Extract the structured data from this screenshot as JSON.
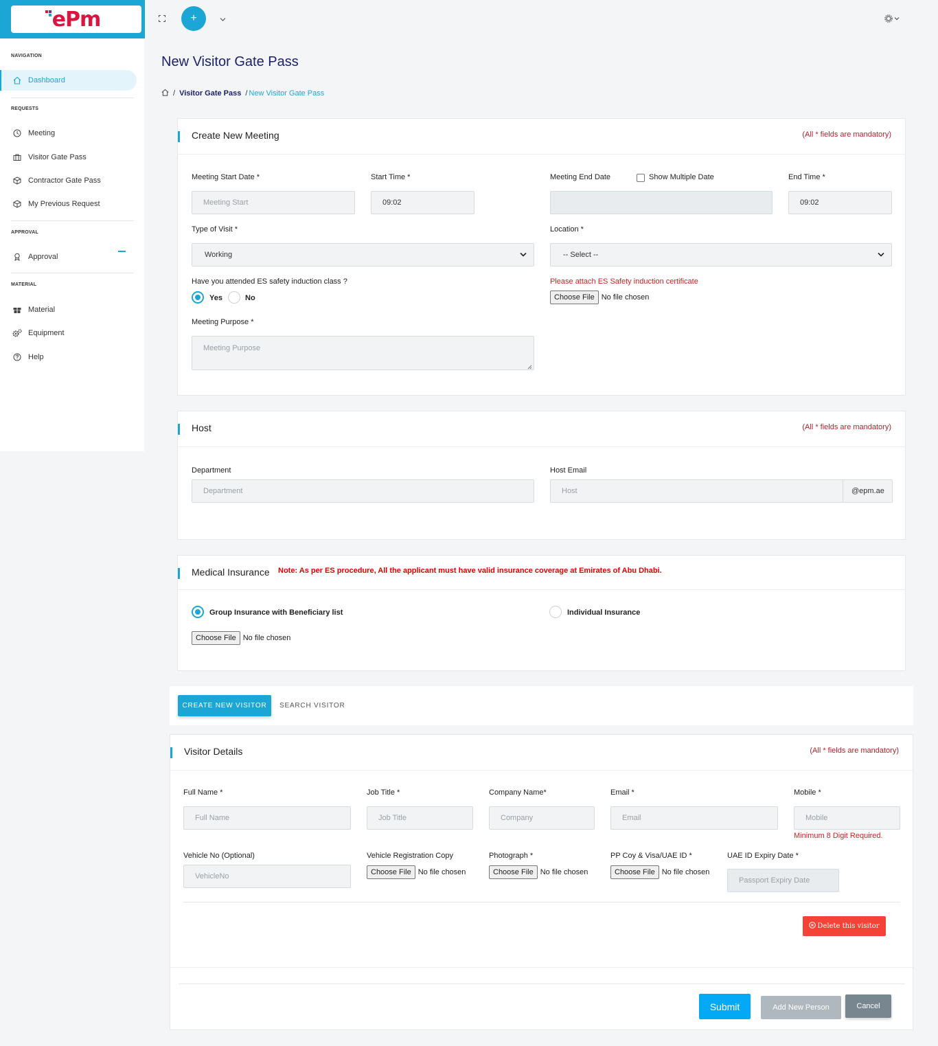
{
  "app": {
    "logo_text": "ePm"
  },
  "sidebar": {
    "sections": {
      "navigation": "NAVIGATION",
      "requests": "REQUESTS",
      "approval": "APPROVAL",
      "material": "MATERIAL"
    },
    "items": [
      {
        "label": "Dashboard",
        "icon": "home-icon",
        "active": true
      },
      {
        "label": "Meeting",
        "icon": "clock-icon"
      },
      {
        "label": "Visitor Gate Pass",
        "icon": "briefcase-icon"
      },
      {
        "label": "Contractor Gate Pass",
        "icon": "cube-network-icon"
      },
      {
        "label": "My Previous Request",
        "icon": "box-icon"
      },
      {
        "label": "Approval",
        "icon": "award-icon"
      },
      {
        "label": "Material",
        "icon": "gift-icon"
      },
      {
        "label": "Equipment",
        "icon": "gears-icon"
      },
      {
        "label": "Help",
        "icon": "question-circle-icon"
      }
    ]
  },
  "topbar": {
    "plus": "+"
  },
  "page": {
    "title": "New Visitor Gate Pass",
    "breadcrumb": {
      "parent": "Visitor Gate Pass",
      "separator": "/",
      "current": "New Visitor Gate Pass"
    }
  },
  "mandatory_note": "(All * fields are mandatory)",
  "meeting": {
    "title": "Create New Meeting",
    "start_date_label": "Meeting Start Date *",
    "start_date_placeholder": "Meeting Start",
    "start_time_label": "Start Time *",
    "start_time_value": "09:02",
    "end_date_label": "Meeting End Date",
    "show_multiple_label": "Show Multiple Date",
    "end_time_label": "End Time *",
    "end_time_value": "09:02",
    "visit_type_label": "Type of Visit *",
    "visit_type_value": "Working",
    "location_label": "Location *",
    "location_value": "-- Select --",
    "safety_question": "Have you attended ES safety induction class ?",
    "yes_label": "Yes",
    "no_label": "No",
    "safety_attach_note": "Please attach ES Safety induction certificate",
    "purpose_label": "Meeting Purpose *",
    "purpose_placeholder": "Meeting Purpose"
  },
  "file_input": {
    "button": "Choose File",
    "status": "No file chosen"
  },
  "host": {
    "title": "Host",
    "department_label": "Department",
    "department_placeholder": "Department",
    "email_label": "Host Email",
    "email_placeholder": "Host",
    "email_suffix": "@epm.ae"
  },
  "insurance": {
    "title": "Medical Insurance",
    "note": "Note: As per ES procedure, All the applicant must have valid insurance coverage at Emirates of Abu Dhabi.",
    "group_label": "Group Insurance with Beneficiary list",
    "individual_label": "Individual Insurance"
  },
  "tabs": {
    "create": "CREATE NEW VISITOR",
    "search": "SEARCH VISITOR"
  },
  "visitor": {
    "title": "Visitor Details",
    "full_name_label": "Full Name *",
    "full_name_placeholder": "Full Name",
    "job_title_label": "Job Title *",
    "job_title_placeholder": "Job Title",
    "company_label": "Company Name*",
    "company_placeholder": "Company",
    "email_label": "Email *",
    "email_placeholder": "Email",
    "mobile_label": "Mobile *",
    "mobile_placeholder": "Mobile",
    "mobile_error": "Minimum 8 Digit Required.",
    "vehicle_label": "Vehicle No (Optional)",
    "vehicle_placeholder": "VehicleNo",
    "vehicle_reg_label": "Vehicle Registration Copy",
    "photo_label": "Photograph *",
    "pp_label": "PP Coy & Visa/UAE ID *",
    "uae_expiry_label": "UAE ID Expiry Date *",
    "uae_expiry_placeholder": "Passport Expiry Date",
    "delete_button": "Delete this visitor"
  },
  "actions": {
    "submit": "Submit",
    "add_new_person": "Add New Person",
    "cancel": "Cancel"
  },
  "colors": {
    "accent": "#1ba6d6",
    "danger": "#f44336",
    "title": "#1a1f6e",
    "cancel": "#78868f",
    "disabled": "#b0b8bf"
  }
}
